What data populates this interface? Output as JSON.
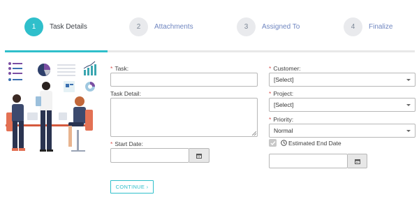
{
  "stepper": {
    "steps": [
      {
        "number": "1",
        "label": "Task Details"
      },
      {
        "number": "2",
        "label": "Attachments"
      },
      {
        "number": "3",
        "label": "Assigned To"
      },
      {
        "number": "4",
        "label": "Finalize"
      }
    ],
    "active_step": 1,
    "progress_fraction": 0.25
  },
  "form": {
    "task_label": "Task:",
    "task_detail_label": "Task Detail:",
    "start_date_label": "Start Date:",
    "customer_label": "Customer:",
    "customer_value": "[Select]",
    "project_label": "Project:",
    "project_value": "[Select]",
    "priority_label": "Priority:",
    "priority_value": "Normal",
    "estimated_end_date_label": "Estimated End Date",
    "estimated_end_date_checked": true,
    "required_mark": "*",
    "continue_label": "CONTINUE ›"
  },
  "colors": {
    "accent": "#2fbfcb",
    "required": "#d9534f",
    "link_blue": "#6f86c0"
  }
}
